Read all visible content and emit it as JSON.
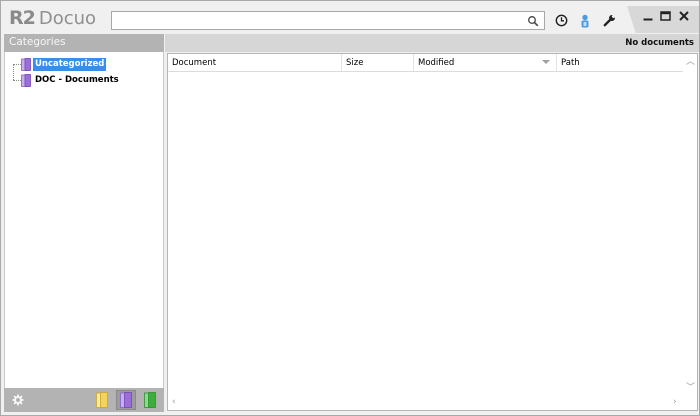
{
  "app": {
    "logo_mark": "R2",
    "logo_name": "Docuo"
  },
  "search": {
    "value": "",
    "placeholder": ""
  },
  "toolbar": {
    "icons": [
      "clock-icon",
      "user-icon",
      "wrench-icon"
    ]
  },
  "window_controls": {
    "icons": [
      "minimize-icon",
      "maximize-icon",
      "close-icon"
    ]
  },
  "left_panel": {
    "title": "Categories",
    "tree": [
      {
        "label": "Uncategorized",
        "selected": true
      },
      {
        "label": "DOC - Documents",
        "selected": false
      }
    ],
    "footer_icons": [
      "gear-icon",
      "yellow-folder-icon",
      "purple-folder-icon",
      "green-folder-icon"
    ]
  },
  "right_panel": {
    "status": "No documents",
    "columns": [
      "Document",
      "Size",
      "Modified",
      "Path"
    ]
  },
  "colors": {
    "selection": "#3a8ee6",
    "folder_purple": "#9b6fd6",
    "folder_yellow": "#f2d35c",
    "folder_green": "#3cae3c",
    "user_icon": "#4a9be0"
  }
}
